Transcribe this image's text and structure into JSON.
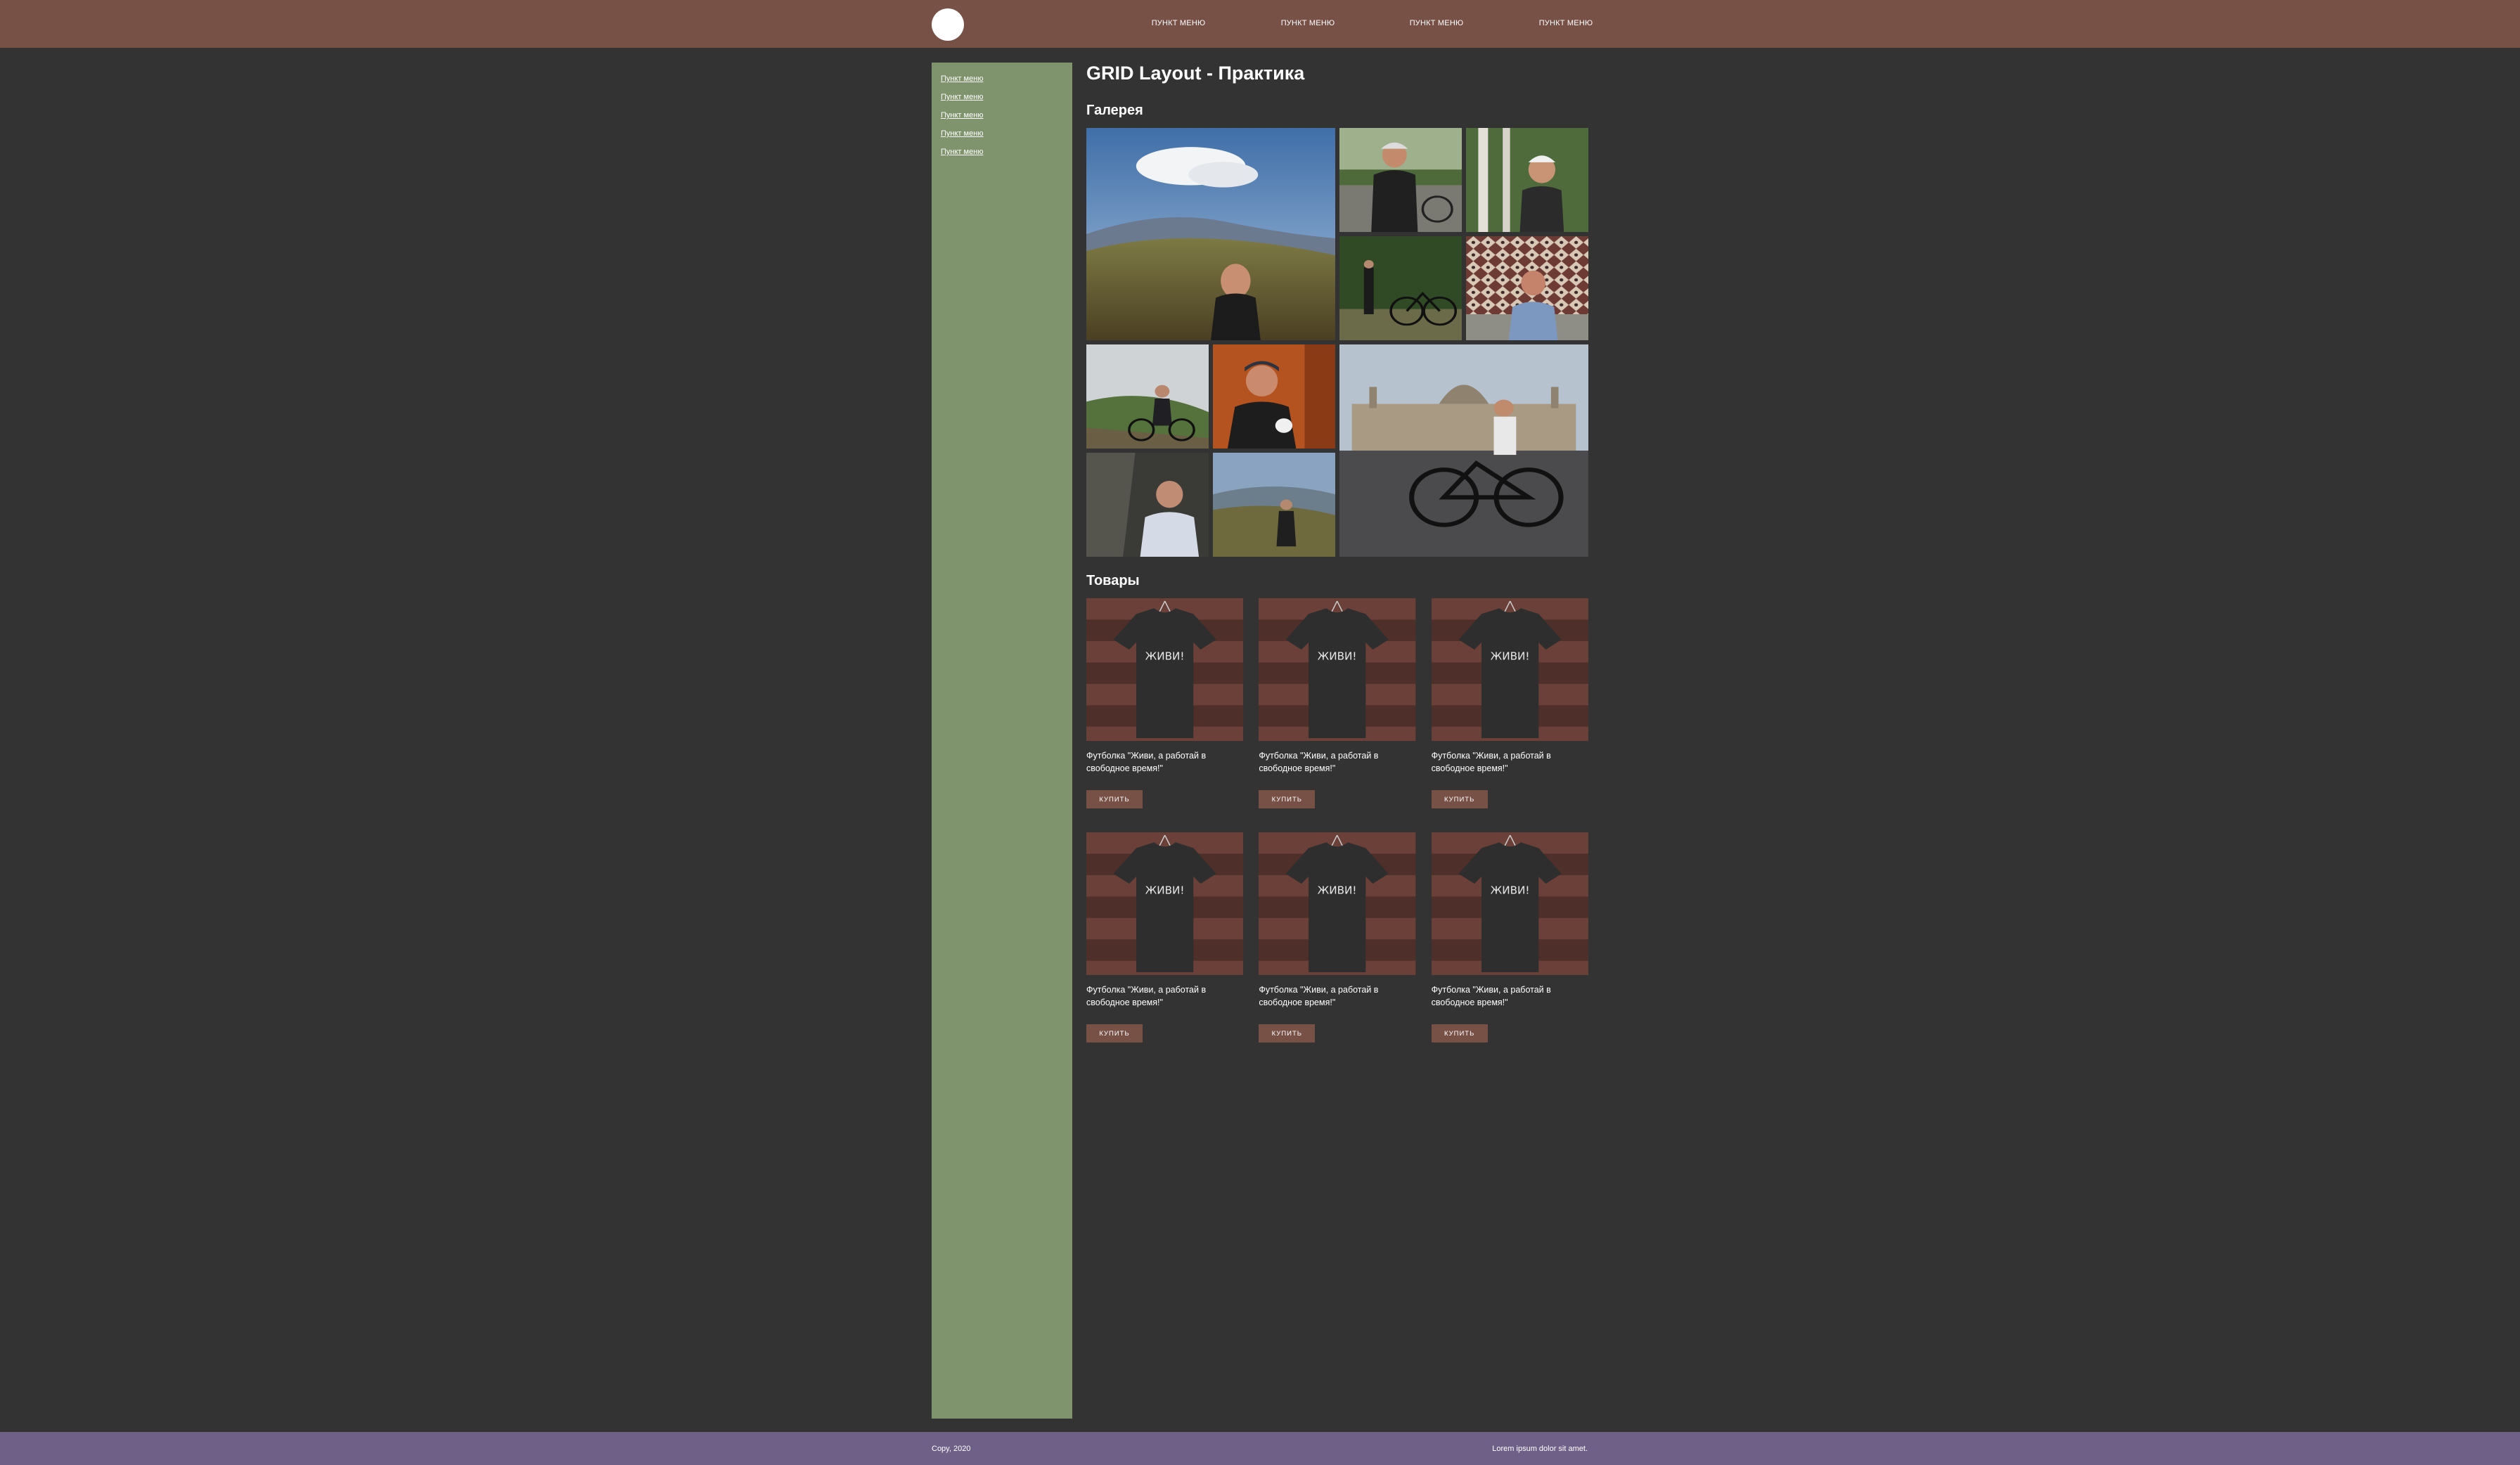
{
  "header": {
    "nav": [
      "Пункт меню",
      "Пункт меню",
      "Пункт меню",
      "Пункт меню"
    ]
  },
  "sidebar": {
    "items": [
      "Пункт меню",
      "Пункт меню",
      "Пункт меню",
      "Пункт меню",
      "Пункт меню"
    ]
  },
  "main": {
    "title": "GRID Layout - Практика",
    "gallery_title": "Галерея",
    "products_title": "Товары",
    "products": [
      {
        "name": "Футболка \"Живи, а работай в свободное время!\"",
        "button": "Купить"
      },
      {
        "name": "Футболка \"Живи, а работай в свободное время!\"",
        "button": "Купить"
      },
      {
        "name": "Футболка \"Живи, а работай в свободное время!\"",
        "button": "Купить"
      },
      {
        "name": "Футболка \"Живи, а работай в свободное время!\"",
        "button": "Купить"
      },
      {
        "name": "Футболка \"Живи, а работай в свободное время!\"",
        "button": "Купить"
      },
      {
        "name": "Футболка \"Живи, а работай в свободное время!\"",
        "button": "Купить"
      }
    ],
    "tshirt_print": "ЖИВИ!"
  },
  "footer": {
    "copyright": "Copy, 2020",
    "text": "Lorem ipsum dolor sit amet."
  },
  "colors": {
    "background": "#333333",
    "header": "#775046",
    "sidebar": "#7f946d",
    "footer": "#6f6087",
    "button": "#775046"
  }
}
